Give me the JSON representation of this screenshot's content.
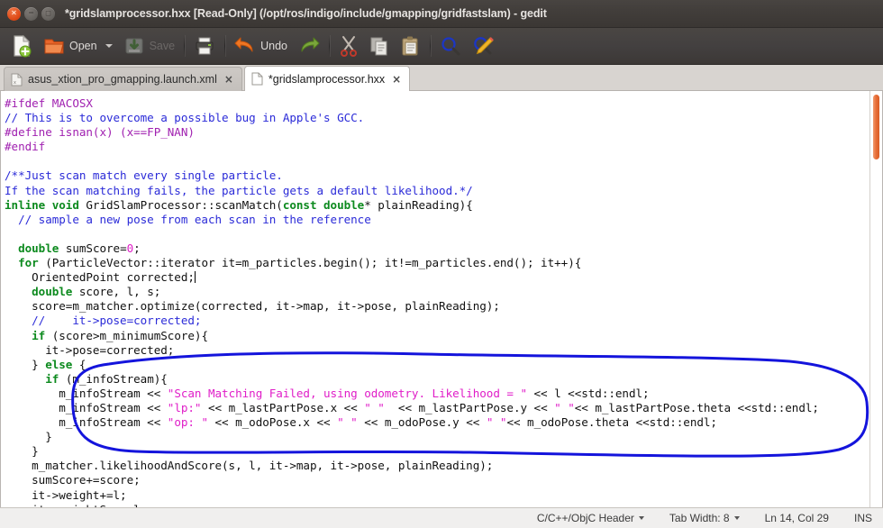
{
  "window": {
    "title": "*gridslamprocessor.hxx [Read-Only] (/opt/ros/indigo/include/gmapping/gridfastslam) - gedit",
    "close_glyph": "×",
    "minimize_glyph": "−",
    "maximize_glyph": "□"
  },
  "toolbar": {
    "new_label": "",
    "open_label": "Open",
    "save_label": "Save",
    "print_label": "",
    "undo_label": "Undo",
    "redo_label": "",
    "cut_label": "",
    "copy_label": "",
    "paste_label": "",
    "find_label": "",
    "replace_label": ""
  },
  "tabs": [
    {
      "label": "asus_xtion_pro_gmapping.launch.xml",
      "close": "×",
      "active": false
    },
    {
      "label": "*gridslamprocessor.hxx",
      "close": "×",
      "active": true
    }
  ],
  "editor": {
    "lines": [
      [
        {
          "t": "#ifdef MACOSX",
          "c": "c-pre"
        }
      ],
      [
        {
          "t": "// This is to overcome a possible bug in Apple's GCC.",
          "c": "c-com"
        }
      ],
      [
        {
          "t": "#define isnan(x) (x==FP_NAN)",
          "c": "c-pre"
        }
      ],
      [
        {
          "t": "#endif",
          "c": "c-pre"
        }
      ],
      [
        {
          "t": "",
          "c": ""
        }
      ],
      [
        {
          "t": "/**Just scan match every single particle.",
          "c": "c-com"
        }
      ],
      [
        {
          "t": "If the scan matching fails, the particle gets a default likelihood.*/",
          "c": "c-com"
        }
      ],
      [
        {
          "t": "inline void",
          "c": "c-key"
        },
        {
          "t": " GridSlamProcessor::scanMatch(",
          "c": ""
        },
        {
          "t": "const double",
          "c": "c-key"
        },
        {
          "t": "* plainReading){",
          "c": ""
        }
      ],
      [
        {
          "t": "  // sample a new pose from each scan in the reference",
          "c": "c-com"
        }
      ],
      [
        {
          "t": "",
          "c": ""
        }
      ],
      [
        {
          "t": "  ",
          "c": ""
        },
        {
          "t": "double",
          "c": "c-key"
        },
        {
          "t": " sumScore=",
          "c": ""
        },
        {
          "t": "0",
          "c": "c-num"
        },
        {
          "t": ";",
          "c": ""
        }
      ],
      [
        {
          "t": "  ",
          "c": ""
        },
        {
          "t": "for",
          "c": "c-key"
        },
        {
          "t": " (ParticleVector::iterator it=m_particles.begin(); it!=m_particles.end(); it++){",
          "c": ""
        }
      ],
      [
        {
          "t": "    OrientedPoint corrected;",
          "c": ""
        },
        {
          "t": "|CARET|",
          "c": "caret"
        }
      ],
      [
        {
          "t": "    ",
          "c": ""
        },
        {
          "t": "double",
          "c": "c-key"
        },
        {
          "t": " score, l, s;",
          "c": ""
        }
      ],
      [
        {
          "t": "    score=m_matcher.optimize(corrected, it->map, it->pose, plainReading);",
          "c": ""
        }
      ],
      [
        {
          "t": "    //    it->pose=corrected;",
          "c": "c-com"
        }
      ],
      [
        {
          "t": "    ",
          "c": ""
        },
        {
          "t": "if",
          "c": "c-key"
        },
        {
          "t": " (score>m_minimumScore){",
          "c": ""
        }
      ],
      [
        {
          "t": "      it->pose=corrected;",
          "c": ""
        }
      ],
      [
        {
          "t": "    } ",
          "c": ""
        },
        {
          "t": "else",
          "c": "c-key"
        },
        {
          "t": " {",
          "c": ""
        }
      ],
      [
        {
          "t": "      ",
          "c": ""
        },
        {
          "t": "if",
          "c": "c-key"
        },
        {
          "t": " (m_infoStream){",
          "c": ""
        }
      ],
      [
        {
          "t": "        m_infoStream << ",
          "c": ""
        },
        {
          "t": "\"Scan Matching Failed, using odometry. Likelihood = \"",
          "c": "c-str"
        },
        {
          "t": " << l <<std::endl;",
          "c": ""
        }
      ],
      [
        {
          "t": "        m_infoStream << ",
          "c": ""
        },
        {
          "t": "\"lp:\"",
          "c": "c-str"
        },
        {
          "t": " << m_lastPartPose.x << ",
          "c": ""
        },
        {
          "t": "\" \"",
          "c": "c-str"
        },
        {
          "t": "  << m_lastPartPose.y << ",
          "c": ""
        },
        {
          "t": "\" \"",
          "c": "c-str"
        },
        {
          "t": "<< m_lastPartPose.theta <<std::endl;",
          "c": ""
        }
      ],
      [
        {
          "t": "        m_infoStream << ",
          "c": ""
        },
        {
          "t": "\"op: \"",
          "c": "c-str"
        },
        {
          "t": " << m_odoPose.x << ",
          "c": ""
        },
        {
          "t": "\" \"",
          "c": "c-str"
        },
        {
          "t": " << m_odoPose.y << ",
          "c": ""
        },
        {
          "t": "\" \"",
          "c": "c-str"
        },
        {
          "t": "<< m_odoPose.theta <<std::endl;",
          "c": ""
        }
      ],
      [
        {
          "t": "      }",
          "c": ""
        }
      ],
      [
        {
          "t": "    }",
          "c": ""
        }
      ],
      [
        {
          "t": "    m_matcher.likelihoodAndScore(s, l, it->map, it->pose, plainReading);",
          "c": ""
        }
      ],
      [
        {
          "t": "    sumScore+=score;",
          "c": ""
        }
      ],
      [
        {
          "t": "    it->weight+=l;",
          "c": ""
        }
      ],
      [
        {
          "t": "    it->weightSum+=l;",
          "c": ""
        }
      ]
    ],
    "scrollbar": {
      "thumb_color": "#e8703a"
    }
  },
  "annotation": {
    "shape": "hand-drawn-ellipse",
    "color": "#1414dc",
    "stroke_width": 3
  },
  "statusbar": {
    "language": "C/C++/ObjC Header",
    "tab_width": "Tab Width: 8",
    "position": "Ln 14, Col 29",
    "insert_mode": "INS"
  }
}
